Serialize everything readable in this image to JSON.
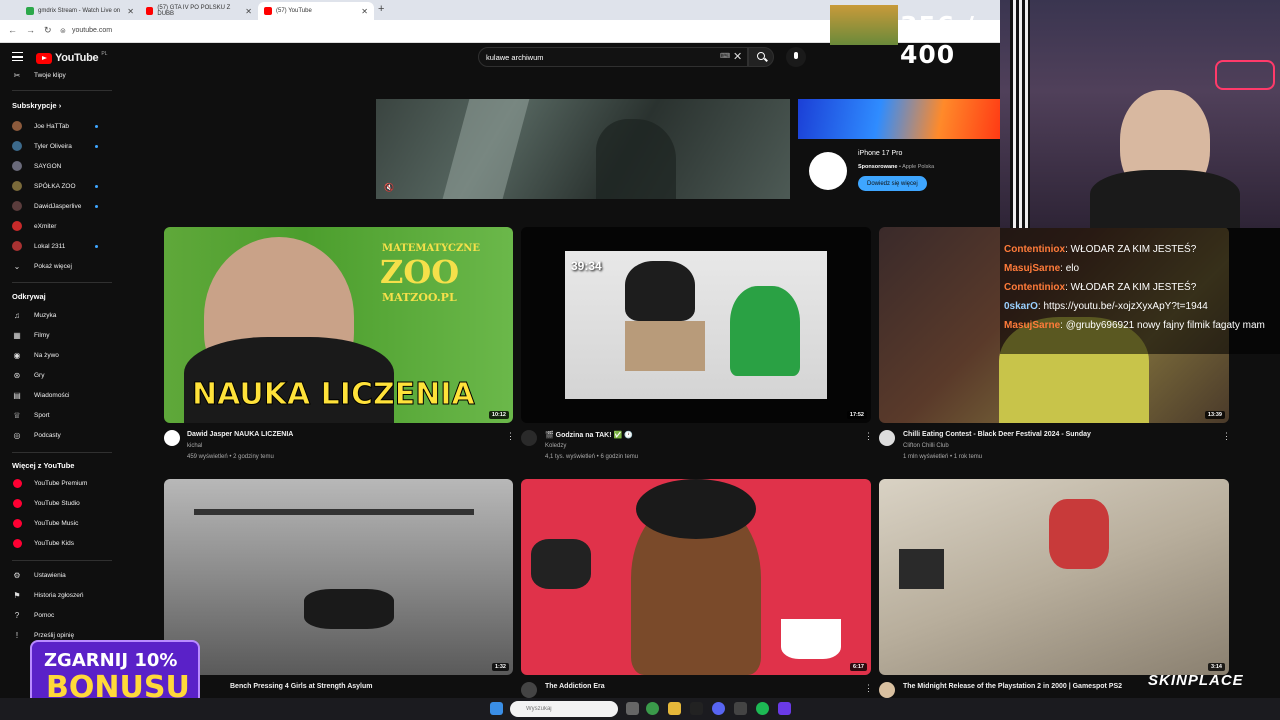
{
  "browser": {
    "tabs": [
      {
        "label": "gmdrix Stream - Watch Live on"
      },
      {
        "label": "(57) GTA IV PO POLSKU Z DUBB"
      },
      {
        "label": "(57) YouTube"
      }
    ],
    "url": "youtube.com"
  },
  "header": {
    "logo": "YouTube",
    "country": "PL",
    "search_value": "kulawe archiwum"
  },
  "sidebar": {
    "top_item": "Twoje klipy",
    "subs_heading": "Subskrypcje",
    "subscriptions": [
      {
        "label": "Joe HaTTab",
        "color": "#8c5a3c",
        "live": true
      },
      {
        "label": "Tyler Oliveira",
        "color": "#3c6a8c",
        "live": true
      },
      {
        "label": "SAYGON",
        "color": "#6a6a7a",
        "live": false
      },
      {
        "label": "SPÓŁKA ZOO",
        "color": "#7a6a3a",
        "live": true
      },
      {
        "label": "DawidJasperlive",
        "color": "#5a3c3c",
        "live": true
      },
      {
        "label": "eXmiter",
        "color": "#c82a2a",
        "live": false
      },
      {
        "label": "Lokal 2311",
        "color": "#a83232",
        "live": true
      }
    ],
    "show_more": "Pokaż więcej",
    "explore_heading": "Odkrywaj",
    "explore": [
      {
        "label": "Muzyka",
        "icon": "music-icon"
      },
      {
        "label": "Filmy",
        "icon": "film-icon"
      },
      {
        "label": "Na żywo",
        "icon": "live-icon"
      },
      {
        "label": "Gry",
        "icon": "gamepad-icon"
      },
      {
        "label": "Wiadomości",
        "icon": "news-icon"
      },
      {
        "label": "Sport",
        "icon": "trophy-icon"
      },
      {
        "label": "Podcasty",
        "icon": "podcast-icon"
      }
    ],
    "more_heading": "Więcej z YouTube",
    "more": [
      {
        "label": "YouTube Premium"
      },
      {
        "label": "YouTube Studio"
      },
      {
        "label": "YouTube Music"
      },
      {
        "label": "YouTube Kids"
      }
    ],
    "settings": [
      {
        "label": "Ustawienia",
        "icon": "gear-icon"
      },
      {
        "label": "Historia zgłoszeń",
        "icon": "flag-icon"
      },
      {
        "label": "Pomoc",
        "icon": "help-icon"
      },
      {
        "label": "Prześlij opinię",
        "icon": "feedback-icon"
      }
    ]
  },
  "ad": {
    "title": "iPhone 17 Pro",
    "sponsored": "Sponsorowane",
    "advertiser": "Apple Polska",
    "cta": "Dowiedz się więcej"
  },
  "videos": [
    {
      "title": "Dawid Jasper NAUKA LICZENIA",
      "channel": "kichal",
      "meta": "459 wyświetleń • 2 godziny temu",
      "duration": "10:12",
      "thumb_text_top": "MATEMATYCZNE",
      "thumb_text_zoo": "ZOO",
      "thumb_text_site": "MATZOO.PL",
      "thumb_text_bottom": "NAUKA LICZENIA"
    },
    {
      "title": "🎬 Godzina na TAK! ✅ 🕐",
      "channel": "Koledzy",
      "meta": "4,1 tys. wyświetleń • 6 godzin temu",
      "duration": "17:52",
      "thumb_time": "39:34"
    },
    {
      "title": "Chilli Eating Contest - Black Deer Festival 2024 - Sunday",
      "channel": "Clifton Chilli Club",
      "meta": "1 mln wyświetleń • 1 rok temu",
      "duration": "13:39"
    },
    {
      "title": "Bench Pressing 4 Girls at Strength Asylum",
      "channel": "",
      "meta": "",
      "duration": "1:32"
    },
    {
      "title": "The Addiction Era",
      "channel": "",
      "meta": "",
      "duration": "6:17"
    },
    {
      "title": "The Midnight Release of the Playstation 2 in 2000 | Gamespot PS2",
      "channel": "",
      "meta": "",
      "duration": "3:14"
    }
  ],
  "chat": [
    {
      "user": "Contentiniox",
      "text": "WŁODAR ZA KIM JESTEŚ?",
      "color": "#ff7b3a"
    },
    {
      "user": "MasujSarne",
      "text": "elo",
      "color": "#ff7b3a"
    },
    {
      "user": "Contentiniox",
      "text": "WŁODAR ZA KIM JESTEŚ?",
      "color": "#ff7b3a"
    },
    {
      "user": "0skarO",
      "text": "https://youtu.be/-xojzXyxApY?t=1944",
      "color": "#9ad0ff"
    },
    {
      "user": "MasujSarne",
      "text": "@gruby696921 nowy fajny filmik fagaty mam",
      "color": "#ff7b3a"
    }
  ],
  "overlay": {
    "counter": "356 / 400",
    "promo_line1": "ZGARNIJ 10%",
    "promo_line2": "BONUSU",
    "brand": "SKINPLACE"
  },
  "taskbar": {
    "search_placeholder": "Wyszukaj"
  }
}
